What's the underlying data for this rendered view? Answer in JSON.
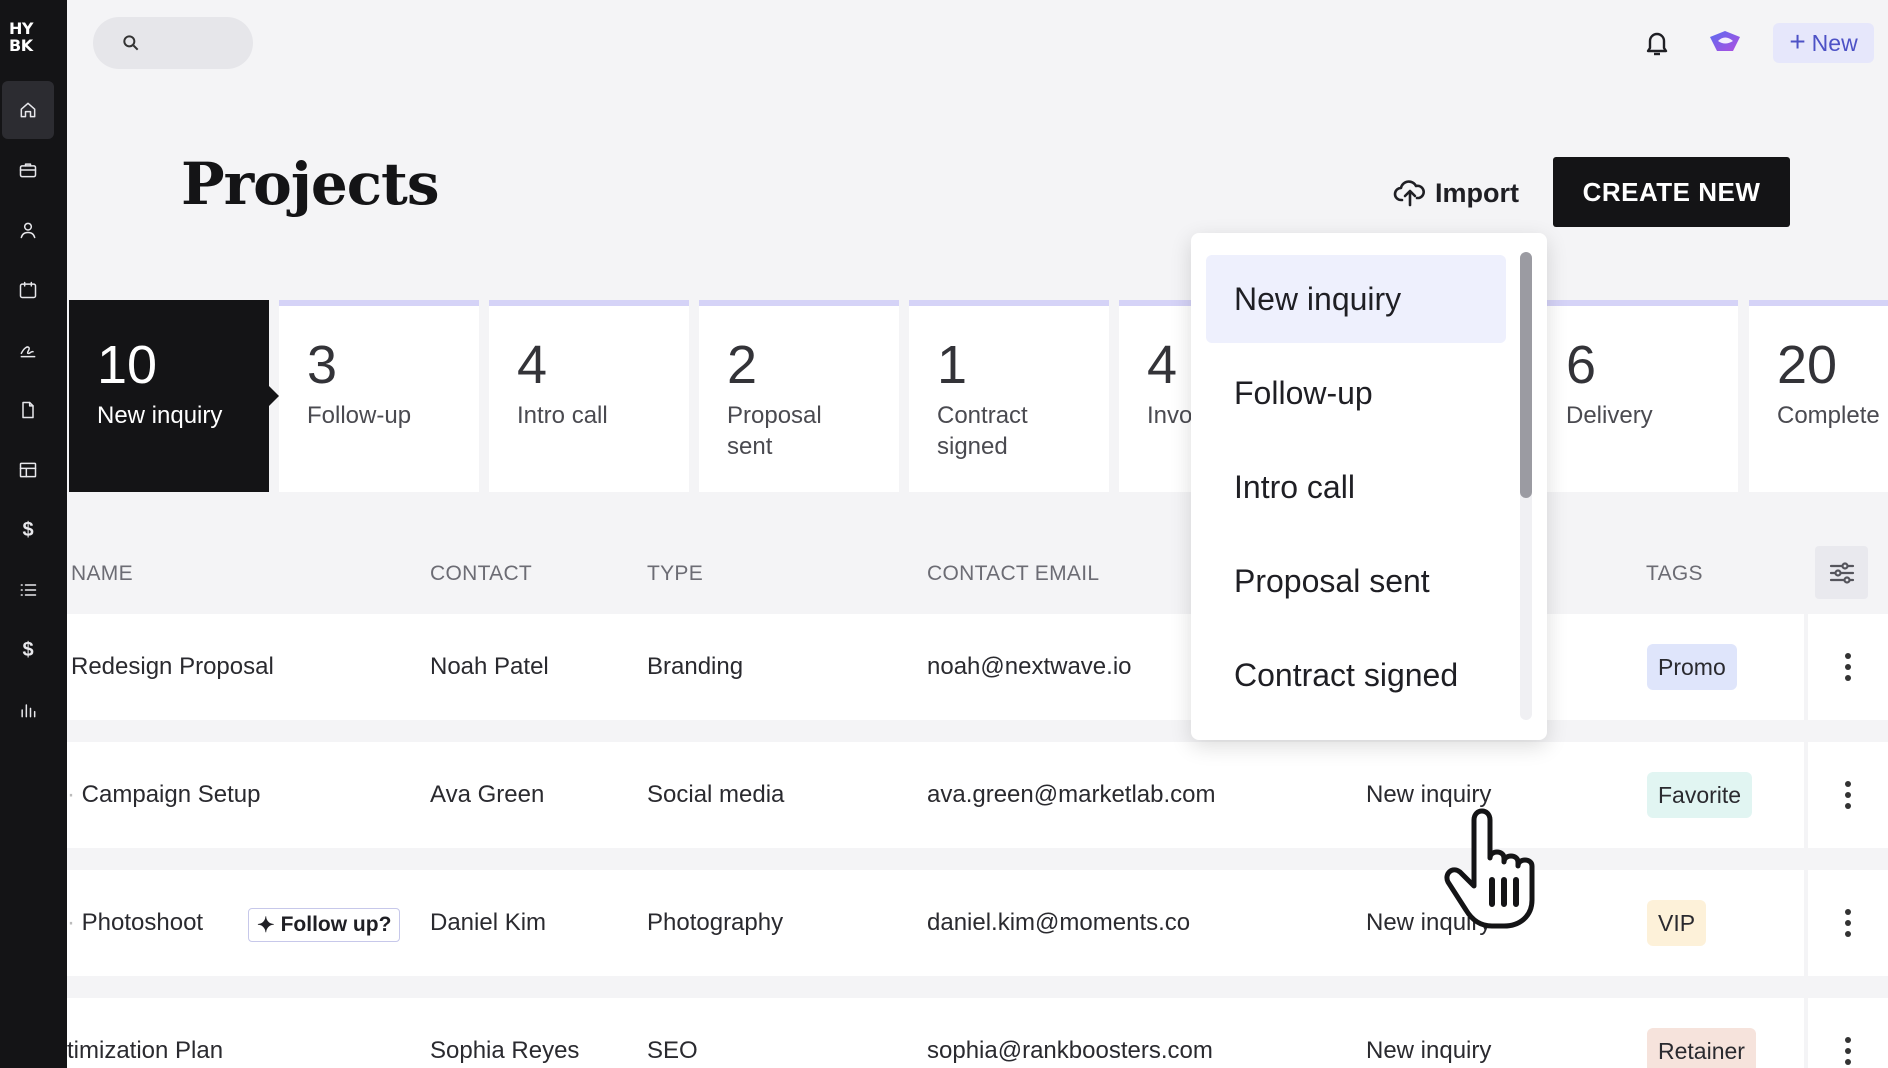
{
  "app": {
    "logo_line1": "HY",
    "logo_line2": "BK"
  },
  "sidebar": {
    "items": [
      {
        "icon": "home-icon"
      },
      {
        "icon": "briefcase-icon"
      },
      {
        "icon": "user-icon"
      },
      {
        "icon": "calendar-icon"
      },
      {
        "icon": "signature-icon"
      },
      {
        "icon": "document-icon"
      },
      {
        "icon": "layout-icon"
      },
      {
        "icon": "dollar-icon",
        "glyph": "$"
      },
      {
        "icon": "list-icon"
      },
      {
        "icon": "dollar-icon",
        "glyph": "$"
      },
      {
        "icon": "bar-chart-icon"
      }
    ]
  },
  "topbar": {
    "new_label": "New",
    "new_plus": "+"
  },
  "header": {
    "title": "Projects",
    "import_label": "Import",
    "create_label": "CREATE NEW"
  },
  "stages": [
    {
      "count": "10",
      "label": "New inquiry"
    },
    {
      "count": "3",
      "label": "Follow-up"
    },
    {
      "count": "4",
      "label": "Intro call"
    },
    {
      "count": "2",
      "label": "Proposal sent"
    },
    {
      "count": "1",
      "label": "Contract signed"
    },
    {
      "count": "4",
      "label": "Invo"
    },
    {
      "count": "6",
      "label": "Delivery"
    },
    {
      "count": "20",
      "label": "Complete"
    }
  ],
  "table": {
    "headers": {
      "name": "NAME",
      "contact": "CONTACT",
      "type": "TYPE",
      "email": "CONTACT EMAIL",
      "tags": "TAGS"
    },
    "rows": [
      {
        "name": "Redesign Proposal",
        "contact": "Noah Patel",
        "type": "Branding",
        "email": "noah@nextwave.io",
        "stage": "",
        "tag": "Promo"
      },
      {
        "name": "Campaign Setup",
        "contact": "Ava Green",
        "type": "Social media",
        "email": "ava.green@marketlab.com",
        "stage": "New inquiry",
        "tag": "Favorite"
      },
      {
        "name": "Photoshoot",
        "followup": "Follow up?",
        "contact": "Daniel Kim",
        "type": "Photography",
        "email": "daniel.kim@moments.co",
        "stage": "New inquiry",
        "tag": "VIP"
      },
      {
        "name": "timization Plan",
        "contact": "Sophia Reyes",
        "type": "SEO",
        "email": "sophia@rankboosters.com",
        "stage": "New inquiry",
        "tag": "Retainer"
      }
    ]
  },
  "dropdown": {
    "options": [
      "New inquiry",
      "Follow-up",
      "Intro call",
      "Proposal sent",
      "Contract signed"
    ],
    "highlighted": "New inquiry"
  },
  "colors": {
    "tag_promo": "#dfe5fb",
    "tag_favorite": "#e1f5f2",
    "tag_vip": "#fdf1d9",
    "tag_retainer": "#f6e3dc",
    "accent": "#4d52c6"
  }
}
